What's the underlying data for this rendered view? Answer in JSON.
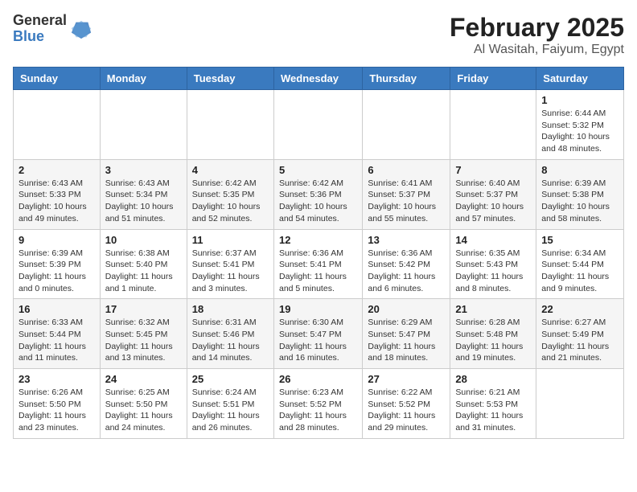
{
  "logo": {
    "general": "General",
    "blue": "Blue"
  },
  "title": {
    "month": "February 2025",
    "location": "Al Wasitah, Faiyum, Egypt"
  },
  "weekdays": [
    "Sunday",
    "Monday",
    "Tuesday",
    "Wednesday",
    "Thursday",
    "Friday",
    "Saturday"
  ],
  "weeks": [
    [
      {
        "day": "",
        "info": ""
      },
      {
        "day": "",
        "info": ""
      },
      {
        "day": "",
        "info": ""
      },
      {
        "day": "",
        "info": ""
      },
      {
        "day": "",
        "info": ""
      },
      {
        "day": "",
        "info": ""
      },
      {
        "day": "1",
        "info": "Sunrise: 6:44 AM\nSunset: 5:32 PM\nDaylight: 10 hours and 48 minutes."
      }
    ],
    [
      {
        "day": "2",
        "info": "Sunrise: 6:43 AM\nSunset: 5:33 PM\nDaylight: 10 hours and 49 minutes."
      },
      {
        "day": "3",
        "info": "Sunrise: 6:43 AM\nSunset: 5:34 PM\nDaylight: 10 hours and 51 minutes."
      },
      {
        "day": "4",
        "info": "Sunrise: 6:42 AM\nSunset: 5:35 PM\nDaylight: 10 hours and 52 minutes."
      },
      {
        "day": "5",
        "info": "Sunrise: 6:42 AM\nSunset: 5:36 PM\nDaylight: 10 hours and 54 minutes."
      },
      {
        "day": "6",
        "info": "Sunrise: 6:41 AM\nSunset: 5:37 PM\nDaylight: 10 hours and 55 minutes."
      },
      {
        "day": "7",
        "info": "Sunrise: 6:40 AM\nSunset: 5:37 PM\nDaylight: 10 hours and 57 minutes."
      },
      {
        "day": "8",
        "info": "Sunrise: 6:39 AM\nSunset: 5:38 PM\nDaylight: 10 hours and 58 minutes."
      }
    ],
    [
      {
        "day": "9",
        "info": "Sunrise: 6:39 AM\nSunset: 5:39 PM\nDaylight: 11 hours and 0 minutes."
      },
      {
        "day": "10",
        "info": "Sunrise: 6:38 AM\nSunset: 5:40 PM\nDaylight: 11 hours and 1 minute."
      },
      {
        "day": "11",
        "info": "Sunrise: 6:37 AM\nSunset: 5:41 PM\nDaylight: 11 hours and 3 minutes."
      },
      {
        "day": "12",
        "info": "Sunrise: 6:36 AM\nSunset: 5:41 PM\nDaylight: 11 hours and 5 minutes."
      },
      {
        "day": "13",
        "info": "Sunrise: 6:36 AM\nSunset: 5:42 PM\nDaylight: 11 hours and 6 minutes."
      },
      {
        "day": "14",
        "info": "Sunrise: 6:35 AM\nSunset: 5:43 PM\nDaylight: 11 hours and 8 minutes."
      },
      {
        "day": "15",
        "info": "Sunrise: 6:34 AM\nSunset: 5:44 PM\nDaylight: 11 hours and 9 minutes."
      }
    ],
    [
      {
        "day": "16",
        "info": "Sunrise: 6:33 AM\nSunset: 5:44 PM\nDaylight: 11 hours and 11 minutes."
      },
      {
        "day": "17",
        "info": "Sunrise: 6:32 AM\nSunset: 5:45 PM\nDaylight: 11 hours and 13 minutes."
      },
      {
        "day": "18",
        "info": "Sunrise: 6:31 AM\nSunset: 5:46 PM\nDaylight: 11 hours and 14 minutes."
      },
      {
        "day": "19",
        "info": "Sunrise: 6:30 AM\nSunset: 5:47 PM\nDaylight: 11 hours and 16 minutes."
      },
      {
        "day": "20",
        "info": "Sunrise: 6:29 AM\nSunset: 5:47 PM\nDaylight: 11 hours and 18 minutes."
      },
      {
        "day": "21",
        "info": "Sunrise: 6:28 AM\nSunset: 5:48 PM\nDaylight: 11 hours and 19 minutes."
      },
      {
        "day": "22",
        "info": "Sunrise: 6:27 AM\nSunset: 5:49 PM\nDaylight: 11 hours and 21 minutes."
      }
    ],
    [
      {
        "day": "23",
        "info": "Sunrise: 6:26 AM\nSunset: 5:50 PM\nDaylight: 11 hours and 23 minutes."
      },
      {
        "day": "24",
        "info": "Sunrise: 6:25 AM\nSunset: 5:50 PM\nDaylight: 11 hours and 24 minutes."
      },
      {
        "day": "25",
        "info": "Sunrise: 6:24 AM\nSunset: 5:51 PM\nDaylight: 11 hours and 26 minutes."
      },
      {
        "day": "26",
        "info": "Sunrise: 6:23 AM\nSunset: 5:52 PM\nDaylight: 11 hours and 28 minutes."
      },
      {
        "day": "27",
        "info": "Sunrise: 6:22 AM\nSunset: 5:52 PM\nDaylight: 11 hours and 29 minutes."
      },
      {
        "day": "28",
        "info": "Sunrise: 6:21 AM\nSunset: 5:53 PM\nDaylight: 11 hours and 31 minutes."
      },
      {
        "day": "",
        "info": ""
      }
    ]
  ]
}
